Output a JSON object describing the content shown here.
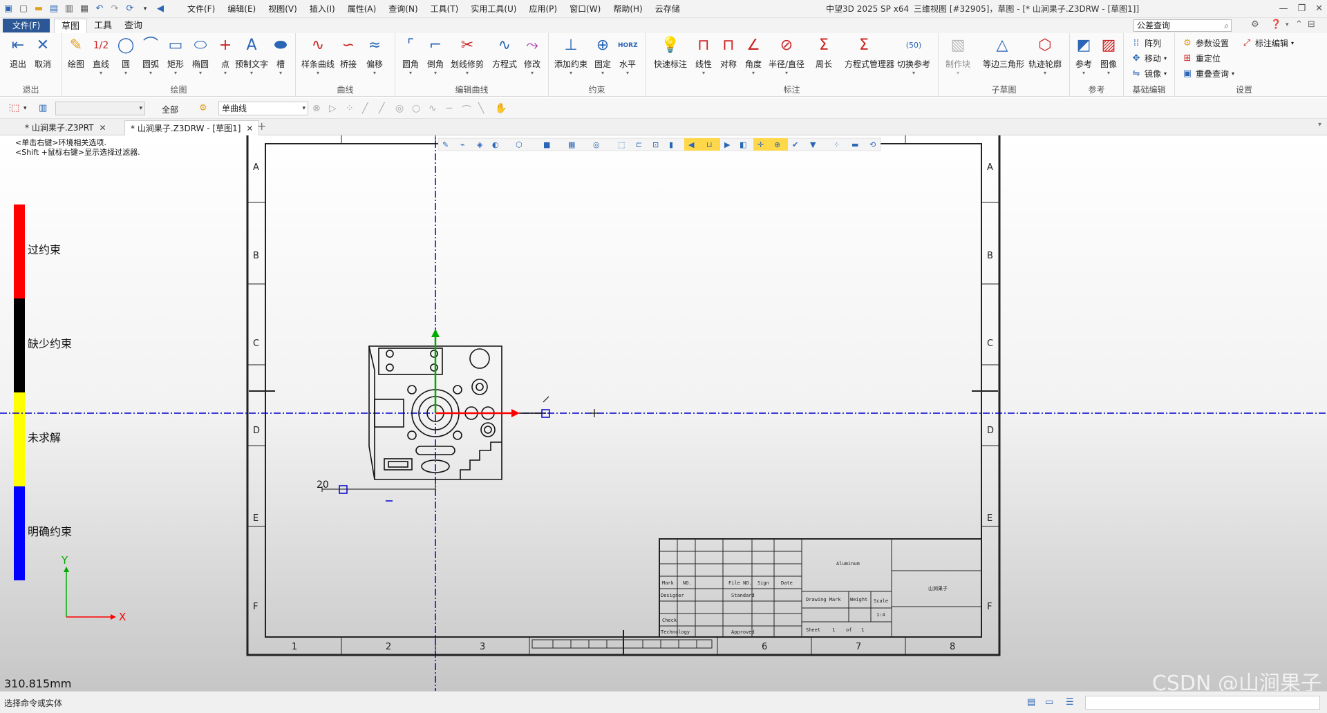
{
  "titlebar": {
    "menus": [
      "文件(F)",
      "编辑(E)",
      "视图(V)",
      "插入(I)",
      "属性(A)",
      "查询(N)",
      "工具(T)",
      "实用工具(U)",
      "应用(P)",
      "窗口(W)",
      "帮助(H)",
      "云存储"
    ],
    "app_info": "中望3D 2025 SP x64",
    "window_title": "三维视图 [#32905]，草图 - [* 山涧果子.Z3DRW - [草图1]]",
    "controls": [
      "—",
      "❐",
      "✕"
    ]
  },
  "ribbon_tabs": {
    "file_tab": "文件(F)",
    "tabs": [
      "草图",
      "工具",
      "查询"
    ],
    "search_value": "公差查询",
    "search_icon": "search-icon"
  },
  "ribbon": {
    "groups": [
      {
        "label": "退出",
        "buttons": [
          "退出",
          "取消"
        ]
      },
      {
        "label": "绘图",
        "buttons": [
          "绘图",
          "直线",
          "圆",
          "圆弧",
          "矩形",
          "椭圆",
          "点",
          "预制文字",
          "槽"
        ]
      },
      {
        "label": "曲线",
        "buttons": [
          "样条曲线",
          "桥接",
          "偏移"
        ]
      },
      {
        "label": "编辑曲线",
        "buttons": [
          "圆角",
          "倒角",
          "划线修剪",
          "方程式",
          "修改"
        ]
      },
      {
        "label": "约束",
        "buttons": [
          "添加约束",
          "固定",
          "水平"
        ]
      },
      {
        "label": "标注",
        "buttons": [
          "快速标注",
          "线性",
          "对称",
          "角度",
          "半径/直径",
          "周长",
          "方程式管理器",
          "切换参考"
        ]
      },
      {
        "label": "子草图",
        "buttons": [
          "制作块",
          "等边三角形",
          "轨迹轮廓"
        ]
      },
      {
        "label": "参考",
        "buttons": [
          "参考",
          "图像"
        ]
      },
      {
        "label": "基础编辑",
        "buttons": [
          "阵列",
          "移动",
          "镜像"
        ]
      },
      {
        "label": "设置",
        "buttons": [
          "参数设置",
          "重定位",
          "重叠查询",
          "标注编辑"
        ]
      }
    ],
    "horz_badge": "HORZ",
    "ratio_badge": "1/2"
  },
  "filterbar": {
    "filter_all": "全部",
    "curve_mode": "单曲线"
  },
  "doc_tabs": [
    {
      "label": "* 山涧果子.Z3PRT",
      "close": "✕"
    },
    {
      "label": "* 山涧果子.Z3DRW - [草图1]",
      "close": "✕"
    }
  ],
  "canvas": {
    "hints": [
      "<单击右键>环境相关选项.",
      "<Shift +鼠标右键>显示选择过滤器."
    ],
    "constraint_legend": [
      {
        "label": "过约束",
        "color": "#ff0000"
      },
      {
        "label": "缺少约束",
        "color": "#000000"
      },
      {
        "label": "未求解",
        "color": "#ffff00"
      },
      {
        "label": "明确约束",
        "color": "#0000ff"
      }
    ],
    "axis_x": "X",
    "axis_y": "Y",
    "measure": "310.815mm",
    "dimension_value": "20",
    "column_numbers": [
      "1",
      "2",
      "3",
      "6",
      "7",
      "8"
    ],
    "row_letters": [
      "A",
      "B",
      "C",
      "D",
      "E",
      "F"
    ],
    "title_block": {
      "material": "Aluminum",
      "part_name": "山涧果子",
      "mark": "Mark",
      "no": "NO.",
      "file_no": "File NO.",
      "sign": "Sign",
      "date": "Date",
      "designer": "Designer",
      "standard": "Standard",
      "check": "Check",
      "technology": "Technology",
      "approved": "Approved",
      "drawing_mark": "Drawing Mark",
      "weight": "Weight",
      "scale": "Scale",
      "scale_value": "1:4",
      "sheet": "Sheet",
      "sheet_num": "1",
      "of": "of",
      "sheet_total": "1"
    },
    "watermark": "CSDN @山涧果子"
  },
  "statusbar": {
    "prompt": "选择命令或实体"
  },
  "colors": {
    "accent": "#2b5797",
    "axis_blue": "#0000cc",
    "axis_red": "#ff0000",
    "axis_green": "#00aa00"
  }
}
